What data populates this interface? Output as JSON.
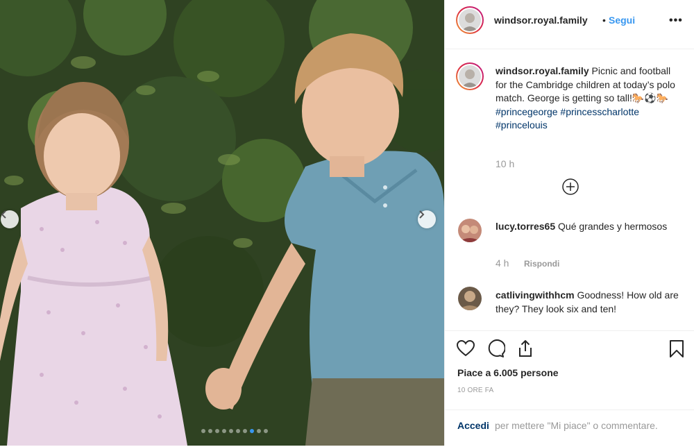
{
  "post": {
    "username": "windsor.royal.family",
    "separator": "•",
    "follow_label": "Segui",
    "more_label": "•••",
    "caption": {
      "username": "windsor.royal.family",
      "text": "Picnic and football for the Cambridge children at today’s polo match. George is getting so tall!🐎⚽🐎",
      "hashtags": [
        "#princegeorge",
        "#princesscharlotte",
        "#princelouis"
      ],
      "time": "10 h"
    },
    "carousel": {
      "slide_count": 10,
      "active_slide": 8
    }
  },
  "comments": [
    {
      "username": "lucy.torres65",
      "text": "Qué grandes y hermosos",
      "time": "4 h",
      "reply_label": "Rispondi"
    },
    {
      "username": "catlivingwithhcm",
      "text": "Goodness! How old are they? They look six and ten!"
    }
  ],
  "actions": {
    "likes_text": "Piace a 6.005 persone",
    "post_age": "10 ORE FA",
    "login_link": "Accedi",
    "login_text": "per mettere \"Mi piace\" o commentare."
  },
  "icons": [
    "heart-icon",
    "comment-icon",
    "share-icon",
    "bookmark-icon",
    "plus-circle-icon",
    "chevron-left-icon",
    "chevron-right-icon"
  ],
  "colors": {
    "link_blue": "#3897f0",
    "hashtag_blue": "#003569",
    "muted_gray": "#999999",
    "text": "#262626"
  }
}
